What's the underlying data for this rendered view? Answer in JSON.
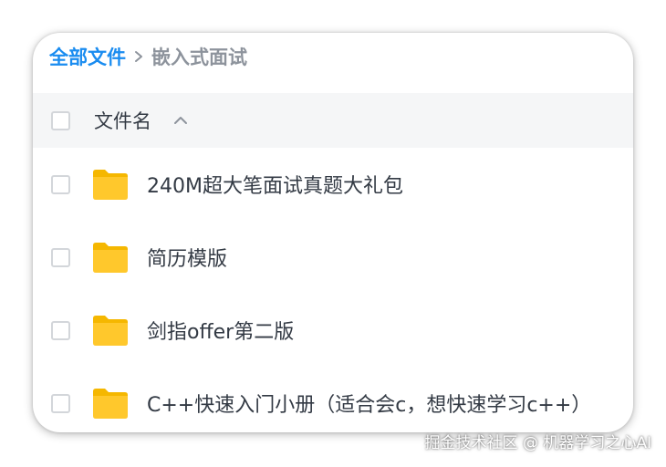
{
  "breadcrumb": {
    "root": "全部文件",
    "separator_icon": "chevron-right-icon",
    "current": "嵌入式面试"
  },
  "table_header": {
    "name_label": "文件名",
    "sort_icon": "chevron-up-icon",
    "sort": "ascending"
  },
  "files": [
    {
      "name": "240M超大笔面试真题大礼包",
      "type": "folder",
      "icon": "folder-icon"
    },
    {
      "name": "简历模版",
      "type": "folder",
      "icon": "folder-icon"
    },
    {
      "name": "剑指offer第二版",
      "type": "folder",
      "icon": "folder-icon"
    },
    {
      "name": "C++快速入门小册（适合会c，想快速学习c++）",
      "type": "folder",
      "icon": "folder-icon"
    }
  ],
  "watermark": "掘金技术社区 @ 机器学习之心AI",
  "colors": {
    "accent": "#1a8cf0",
    "folder": "#ffc82c",
    "folder_tab": "#f5b700",
    "text": "#333a44",
    "muted": "#8d939c",
    "header_bg": "#f5f6f7"
  }
}
